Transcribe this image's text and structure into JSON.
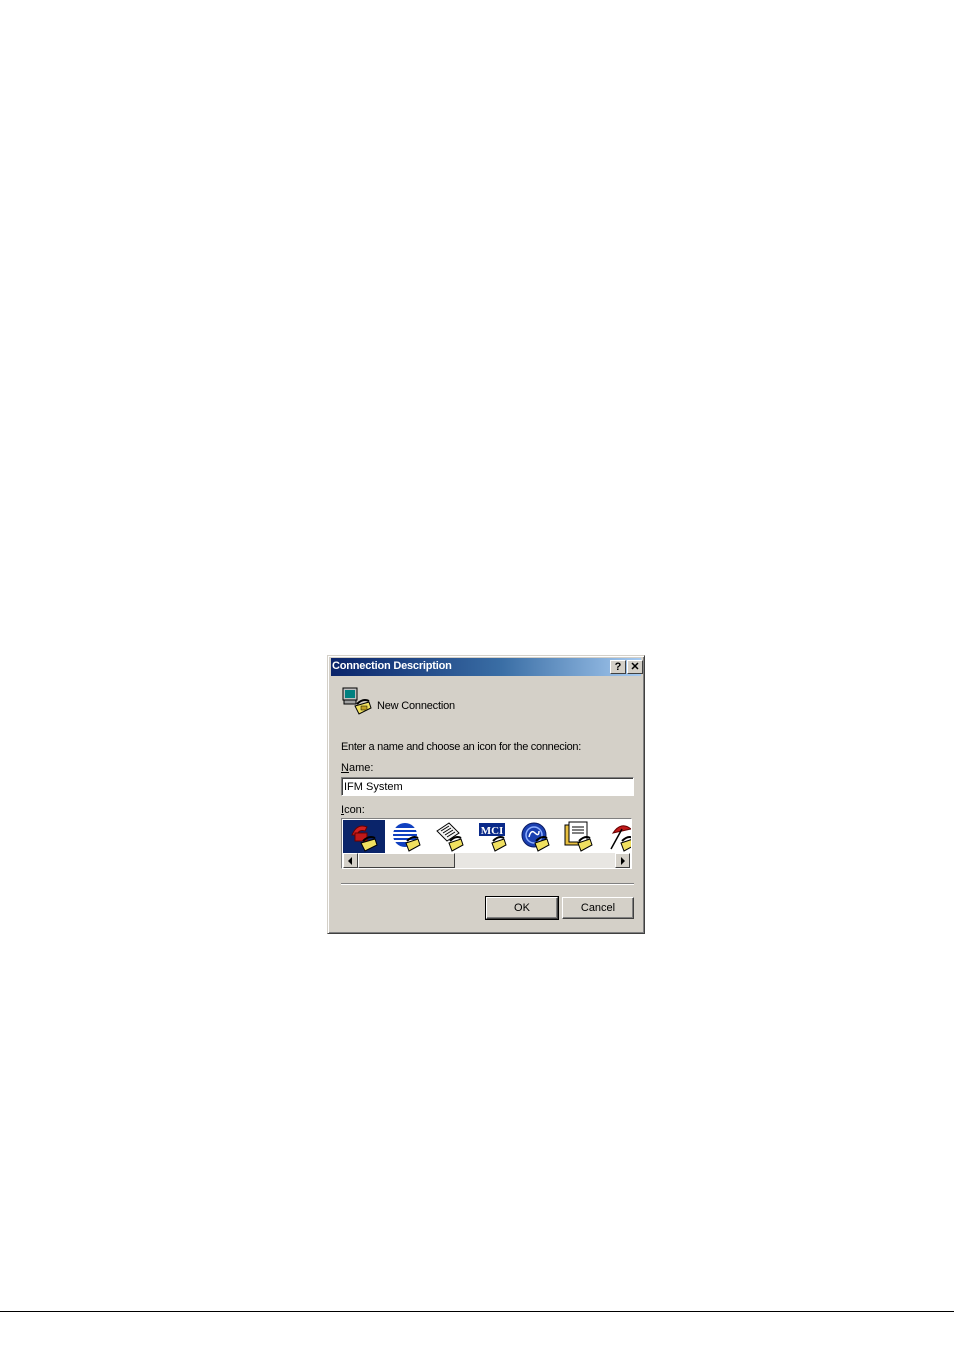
{
  "dialog": {
    "title": "Connection Description",
    "help_button": "?",
    "close_button": "✕",
    "header_label": "New Connection",
    "prompt": "Enter a name and choose an icon for the connecion:",
    "name_label": "Name:",
    "name_value": "IFM System",
    "icon_label": "Icon:",
    "icons": [
      {
        "name": "red-telephone-icon",
        "selected": true
      },
      {
        "name": "globe-stripes-icon",
        "selected": false
      },
      {
        "name": "newspaper-icon",
        "selected": false
      },
      {
        "name": "mci-logo-icon",
        "text": "MCI",
        "selected": false
      },
      {
        "name": "ge-globe-icon",
        "selected": false
      },
      {
        "name": "documents-icon",
        "selected": false
      },
      {
        "name": "umbrella-icon",
        "selected": false
      }
    ],
    "ok_label": "OK",
    "cancel_label": "Cancel"
  }
}
